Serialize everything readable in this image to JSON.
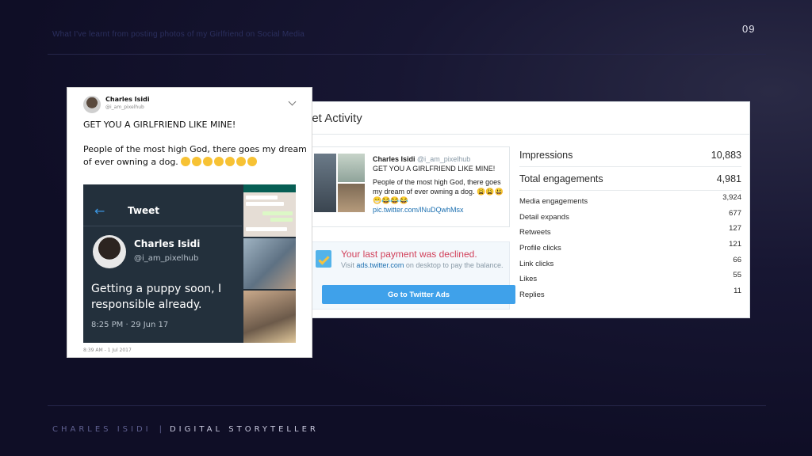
{
  "slide": {
    "header_title": "What I've learnt from posting photos of my Girlfriend on Social Media",
    "page_number": "09",
    "footer_name": "CHARLES ISIDI",
    "footer_separator": "|",
    "footer_role": "DIGITAL STORYTELLER"
  },
  "activity": {
    "title": "eet Activity",
    "tweet": {
      "author": "Charles Isidi",
      "handle": "@i_am_pixelhub",
      "line1": "GET YOU A GIRLFRIEND LIKE MINE!",
      "line2": "People of the most high God, there goes my dream of ever owning a dog. 😩😩😃😁😂😂😂",
      "link": "pic.twitter.com/lNuDQwhMsx"
    },
    "alert": {
      "title": "Your last payment was declined.",
      "body_prefix": "Visit ",
      "body_link": "ads.twitter.com",
      "body_suffix": " on desktop to pay the balance.",
      "button_label": "Go to Twitter Ads"
    },
    "metrics_primary": [
      {
        "label": "Impressions",
        "value": "10,883"
      },
      {
        "label": "Total engagements",
        "value": "4,981"
      }
    ],
    "metrics_detail": [
      {
        "label": "Media engagements",
        "value": "3,924"
      },
      {
        "label": "Detail expands",
        "value": "677"
      },
      {
        "label": "Retweets",
        "value": "127"
      },
      {
        "label": "Profile clicks",
        "value": "121"
      },
      {
        "label": "Link clicks",
        "value": "66"
      },
      {
        "label": "Likes",
        "value": "55"
      },
      {
        "label": "Replies",
        "value": "11"
      }
    ]
  },
  "phone": {
    "author": "Charles Isidi",
    "handle": "@i_am_pixelhub",
    "line1": "GET YOU A GIRLFRIEND LIKE MINE!",
    "line2": "People of the most high God, there goes my dream of ever owning a dog.",
    "emoji_count": 7,
    "post_date": "8:39 AM - 1 Jul 2017",
    "embedded": {
      "title": "Tweet",
      "name": "Charles Isidi",
      "handle": "@i_am_pixelhub",
      "text_line1": "Getting a puppy soon, I",
      "text_line2": "responsible already.",
      "time": "8:25 PM · 29 Jun 17"
    }
  },
  "colors": {
    "background": "#0f0e26",
    "alert_red": "#d1405a",
    "button_blue": "#3fa1ea",
    "link_blue": "#1b6fb0"
  }
}
